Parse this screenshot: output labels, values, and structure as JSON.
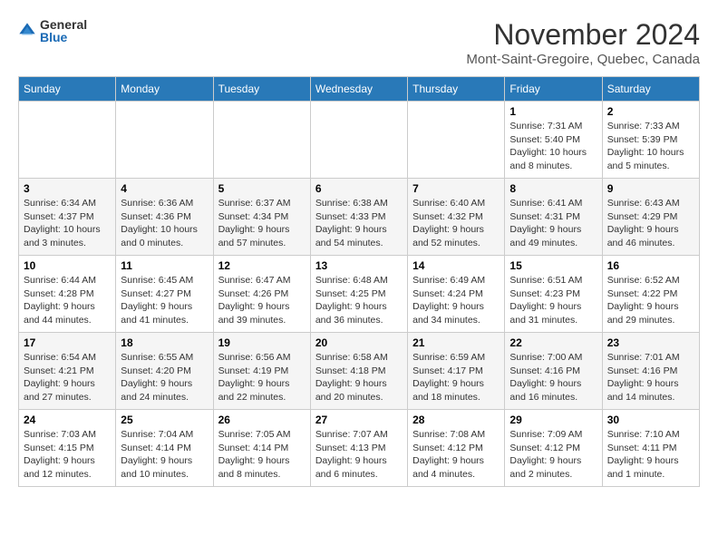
{
  "logo": {
    "general": "General",
    "blue": "Blue"
  },
  "header": {
    "month": "November 2024",
    "location": "Mont-Saint-Gregoire, Quebec, Canada"
  },
  "weekdays": [
    "Sunday",
    "Monday",
    "Tuesday",
    "Wednesday",
    "Thursday",
    "Friday",
    "Saturday"
  ],
  "rows": [
    [
      {
        "day": "",
        "content": ""
      },
      {
        "day": "",
        "content": ""
      },
      {
        "day": "",
        "content": ""
      },
      {
        "day": "",
        "content": ""
      },
      {
        "day": "",
        "content": ""
      },
      {
        "day": "1",
        "content": "Sunrise: 7:31 AM\nSunset: 5:40 PM\nDaylight: 10 hours and 8 minutes."
      },
      {
        "day": "2",
        "content": "Sunrise: 7:33 AM\nSunset: 5:39 PM\nDaylight: 10 hours and 5 minutes."
      }
    ],
    [
      {
        "day": "3",
        "content": "Sunrise: 6:34 AM\nSunset: 4:37 PM\nDaylight: 10 hours and 3 minutes."
      },
      {
        "day": "4",
        "content": "Sunrise: 6:36 AM\nSunset: 4:36 PM\nDaylight: 10 hours and 0 minutes."
      },
      {
        "day": "5",
        "content": "Sunrise: 6:37 AM\nSunset: 4:34 PM\nDaylight: 9 hours and 57 minutes."
      },
      {
        "day": "6",
        "content": "Sunrise: 6:38 AM\nSunset: 4:33 PM\nDaylight: 9 hours and 54 minutes."
      },
      {
        "day": "7",
        "content": "Sunrise: 6:40 AM\nSunset: 4:32 PM\nDaylight: 9 hours and 52 minutes."
      },
      {
        "day": "8",
        "content": "Sunrise: 6:41 AM\nSunset: 4:31 PM\nDaylight: 9 hours and 49 minutes."
      },
      {
        "day": "9",
        "content": "Sunrise: 6:43 AM\nSunset: 4:29 PM\nDaylight: 9 hours and 46 minutes."
      }
    ],
    [
      {
        "day": "10",
        "content": "Sunrise: 6:44 AM\nSunset: 4:28 PM\nDaylight: 9 hours and 44 minutes."
      },
      {
        "day": "11",
        "content": "Sunrise: 6:45 AM\nSunset: 4:27 PM\nDaylight: 9 hours and 41 minutes."
      },
      {
        "day": "12",
        "content": "Sunrise: 6:47 AM\nSunset: 4:26 PM\nDaylight: 9 hours and 39 minutes."
      },
      {
        "day": "13",
        "content": "Sunrise: 6:48 AM\nSunset: 4:25 PM\nDaylight: 9 hours and 36 minutes."
      },
      {
        "day": "14",
        "content": "Sunrise: 6:49 AM\nSunset: 4:24 PM\nDaylight: 9 hours and 34 minutes."
      },
      {
        "day": "15",
        "content": "Sunrise: 6:51 AM\nSunset: 4:23 PM\nDaylight: 9 hours and 31 minutes."
      },
      {
        "day": "16",
        "content": "Sunrise: 6:52 AM\nSunset: 4:22 PM\nDaylight: 9 hours and 29 minutes."
      }
    ],
    [
      {
        "day": "17",
        "content": "Sunrise: 6:54 AM\nSunset: 4:21 PM\nDaylight: 9 hours and 27 minutes."
      },
      {
        "day": "18",
        "content": "Sunrise: 6:55 AM\nSunset: 4:20 PM\nDaylight: 9 hours and 24 minutes."
      },
      {
        "day": "19",
        "content": "Sunrise: 6:56 AM\nSunset: 4:19 PM\nDaylight: 9 hours and 22 minutes."
      },
      {
        "day": "20",
        "content": "Sunrise: 6:58 AM\nSunset: 4:18 PM\nDaylight: 9 hours and 20 minutes."
      },
      {
        "day": "21",
        "content": "Sunrise: 6:59 AM\nSunset: 4:17 PM\nDaylight: 9 hours and 18 minutes."
      },
      {
        "day": "22",
        "content": "Sunrise: 7:00 AM\nSunset: 4:16 PM\nDaylight: 9 hours and 16 minutes."
      },
      {
        "day": "23",
        "content": "Sunrise: 7:01 AM\nSunset: 4:16 PM\nDaylight: 9 hours and 14 minutes."
      }
    ],
    [
      {
        "day": "24",
        "content": "Sunrise: 7:03 AM\nSunset: 4:15 PM\nDaylight: 9 hours and 12 minutes."
      },
      {
        "day": "25",
        "content": "Sunrise: 7:04 AM\nSunset: 4:14 PM\nDaylight: 9 hours and 10 minutes."
      },
      {
        "day": "26",
        "content": "Sunrise: 7:05 AM\nSunset: 4:14 PM\nDaylight: 9 hours and 8 minutes."
      },
      {
        "day": "27",
        "content": "Sunrise: 7:07 AM\nSunset: 4:13 PM\nDaylight: 9 hours and 6 minutes."
      },
      {
        "day": "28",
        "content": "Sunrise: 7:08 AM\nSunset: 4:12 PM\nDaylight: 9 hours and 4 minutes."
      },
      {
        "day": "29",
        "content": "Sunrise: 7:09 AM\nSunset: 4:12 PM\nDaylight: 9 hours and 2 minutes."
      },
      {
        "day": "30",
        "content": "Sunrise: 7:10 AM\nSunset: 4:11 PM\nDaylight: 9 hours and 1 minute."
      }
    ]
  ]
}
